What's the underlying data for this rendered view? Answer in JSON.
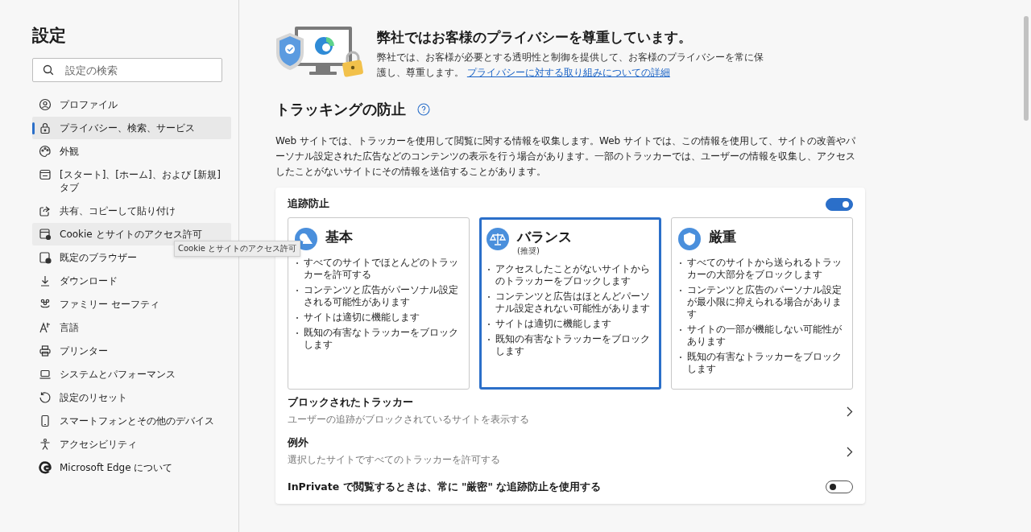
{
  "sidebar": {
    "title": "設定",
    "search": {
      "placeholder": "設定の検索"
    },
    "items": [
      {
        "label": "プロファイル",
        "selected": false,
        "hovered": false
      },
      {
        "label": "プライバシー、検索、サービス",
        "selected": true,
        "hovered": false
      },
      {
        "label": "外観",
        "selected": false,
        "hovered": false
      },
      {
        "label": "[スタート]、[ホーム]、および [新規] タブ",
        "selected": false,
        "hovered": false
      },
      {
        "label": "共有、コピーして貼り付け",
        "selected": false,
        "hovered": false
      },
      {
        "label": "Cookie とサイトのアクセス許可",
        "selected": false,
        "hovered": true
      },
      {
        "label": "既定のブラウザー",
        "selected": false,
        "hovered": false
      },
      {
        "label": "ダウンロード",
        "selected": false,
        "hovered": false
      },
      {
        "label": "ファミリー セーフティ",
        "selected": false,
        "hovered": false
      },
      {
        "label": "言語",
        "selected": false,
        "hovered": false
      },
      {
        "label": "プリンター",
        "selected": false,
        "hovered": false
      },
      {
        "label": "システムとパフォーマンス",
        "selected": false,
        "hovered": false
      },
      {
        "label": "設定のリセット",
        "selected": false,
        "hovered": false
      },
      {
        "label": "スマートフォンとその他のデバイス",
        "selected": false,
        "hovered": false
      },
      {
        "label": "アクセシビリティ",
        "selected": false,
        "hovered": false
      },
      {
        "label": "Microsoft Edge について",
        "selected": false,
        "hovered": false
      }
    ],
    "tooltip": "Cookie とサイトのアクセス許可"
  },
  "banner": {
    "title": "弊社ではお客様のプライバシーを尊重しています。",
    "text": "弊社では、お客様が必要とする透明性と制御を提供して、お客様のプライバシーを常に保護し、尊重します。",
    "link": "プライバシーに対する取り組みについての詳細"
  },
  "tracking": {
    "title": "トラッキングの防止",
    "description": "Web サイトでは、トラッカーを使用して閲覧に関する情報を収集します。Web サイトでは、この情報を使用して、サイトの改善やパーソナル設定された広告などのコンテンツの表示を行う場合があります。一部のトラッカーでは、ユーザーの情報を収集し、アクセスしたことがないサイトにその情報を送信することがあります。",
    "toggle": {
      "label": "追跡防止",
      "on": true
    },
    "levels": [
      {
        "title": "基本",
        "selected": false,
        "bullets": [
          "すべてのサイトでほとんどのトラッカーを許可する",
          "コンテンツと広告がパーソナル設定される可能性があります",
          "サイトは適切に機能します",
          "既知の有害なトラッカーをブロックします"
        ]
      },
      {
        "title": "バランス",
        "subtitle": "(推奨)",
        "selected": true,
        "bullets": [
          "アクセスしたことがないサイトからのトラッカーをブロックします",
          "コンテンツと広告はほとんどパーソナル設定されない可能性があります",
          "サイトは適切に機能します",
          "既知の有害なトラッカーをブロックします"
        ]
      },
      {
        "title": "厳重",
        "selected": false,
        "bullets": [
          "すべてのサイトから送られるトラッカーの大部分をブロックします",
          "コンテンツと広告のパーソナル設定が最小限に抑えられる場合があります",
          "サイトの一部が機能しない可能性があります",
          "既知の有害なトラッカーをブロックします"
        ]
      }
    ],
    "links": [
      {
        "title": "ブロックされたトラッカー",
        "subtitle": "ユーザーの追跡がブロックされているサイトを表示する"
      },
      {
        "title": "例外",
        "subtitle": "選択したサイトですべてのトラッカーを許可する"
      }
    ],
    "inprivate": {
      "label": "InPrivate で閲覧するときは、常に \"厳密\" な追跡防止を使用する",
      "on": false
    }
  }
}
